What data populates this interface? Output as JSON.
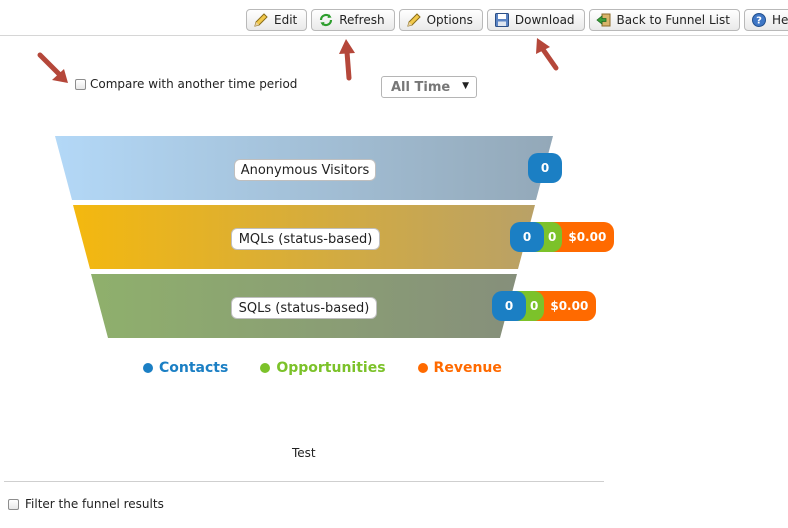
{
  "toolbar": {
    "buttons": [
      {
        "label": "Edit",
        "icon": "pencil-icon"
      },
      {
        "label": "Refresh",
        "icon": "refresh-icon"
      },
      {
        "label": "Options",
        "icon": "pencil-icon"
      },
      {
        "label": "Download",
        "icon": "floppy-disk-icon"
      },
      {
        "label": "Back to Funnel List",
        "icon": "back-arrow-icon"
      },
      {
        "label": "Help",
        "icon": "help-icon"
      }
    ]
  },
  "compare": {
    "label": "Compare with another time period",
    "checked": false
  },
  "period_select": {
    "value": "All Time"
  },
  "funnel": {
    "stages": [
      {
        "label": "Anonymous Visitors",
        "contacts": "0"
      },
      {
        "label": "MQLs (status-based)",
        "contacts": "0",
        "opportunities": "0",
        "revenue": "$0.00"
      },
      {
        "label": "SQLs (status-based)",
        "contacts": "0",
        "opportunities": "0",
        "revenue": "$0.00"
      }
    ]
  },
  "legend": {
    "items": [
      {
        "label": "Contacts",
        "color": "#1b7fc4"
      },
      {
        "label": "Opportunities",
        "color": "#7cc22a"
      },
      {
        "label": "Revenue",
        "color": "#ff6a00"
      }
    ]
  },
  "caption": "Test",
  "filter": {
    "label": "Filter the funnel results",
    "checked": false
  },
  "colors": {
    "stage1_from": "#b3d8f7",
    "stage1_to": "#93a8b8",
    "stage2_from": "#f4b80f",
    "stage2_to": "#b9a167",
    "stage3_from": "#8fb06c",
    "stage3_to": "#868f7b",
    "annotation_arrow": "#b5473a"
  }
}
